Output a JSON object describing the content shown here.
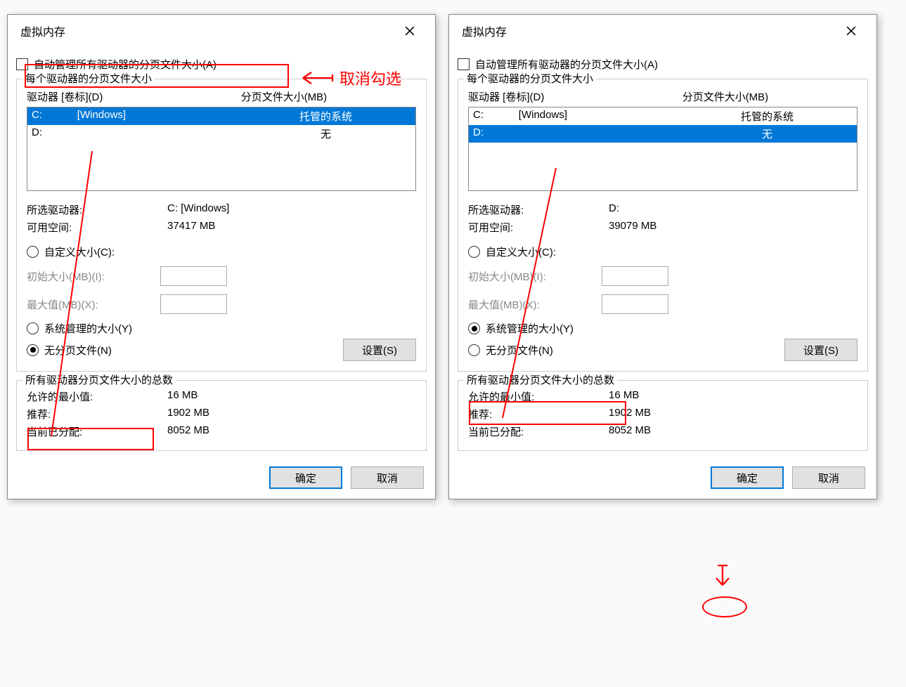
{
  "left": {
    "title": "虚拟内存",
    "auto_manage_label": "自动管理所有驱动器的分页文件大小(A)",
    "fieldset1_title": "每个驱动器的分页文件大小",
    "drive_col1": "驱动器 [卷标](D)",
    "drive_col2": "分页文件大小(MB)",
    "drives": [
      {
        "letter": "C:",
        "label": "[Windows]",
        "size": "托管的系统",
        "selected": true
      },
      {
        "letter": "D:",
        "label": "",
        "size": "无",
        "selected": false
      }
    ],
    "selected_drive_label": "所选驱动器:",
    "selected_drive_value": "C:  [Windows]",
    "available_label": "可用空间:",
    "available_value": "37417 MB",
    "custom_radio": "自定义大小(C):",
    "initial_label": "初始大小(MB)(I):",
    "max_label": "最大值(MB)(X):",
    "sysmgd_radio": "系统管理的大小(Y)",
    "nopagefile_radio": "无分页文件(N)",
    "set_btn": "设置(S)",
    "fieldset2_title": "所有驱动器分页文件大小的总数",
    "min_label": "允许的最小值:",
    "min_value": "16 MB",
    "rec_label": "推荐:",
    "rec_value": "1902 MB",
    "cur_label": "当前已分配:",
    "cur_value": "8052 MB",
    "ok_btn": "确定",
    "cancel_btn": "取消",
    "anno_text": "取消勾选"
  },
  "right": {
    "title": "虚拟内存",
    "auto_manage_label": "自动管理所有驱动器的分页文件大小(A)",
    "fieldset1_title": "每个驱动器的分页文件大小",
    "drive_col1": "驱动器 [卷标](D)",
    "drive_col2": "分页文件大小(MB)",
    "drives": [
      {
        "letter": "C:",
        "label": "[Windows]",
        "size": "托管的系统",
        "selected": false
      },
      {
        "letter": "D:",
        "label": "",
        "size": "无",
        "selected": true
      }
    ],
    "selected_drive_label": "所选驱动器:",
    "selected_drive_value": "D:",
    "available_label": "可用空间:",
    "available_value": "39079 MB",
    "custom_radio": "自定义大小(C):",
    "initial_label": "初始大小(MB)(I):",
    "max_label": "最大值(MB)(X):",
    "sysmgd_radio": "系统管理的大小(Y)",
    "nopagefile_radio": "无分页文件(N)",
    "set_btn": "设置(S)",
    "fieldset2_title": "所有驱动器分页文件大小的总数",
    "min_label": "允许的最小值:",
    "min_value": "16 MB",
    "rec_label": "推荐:",
    "rec_value": "1902 MB",
    "cur_label": "当前已分配:",
    "cur_value": "8052 MB",
    "ok_btn": "确定",
    "cancel_btn": "取消"
  }
}
